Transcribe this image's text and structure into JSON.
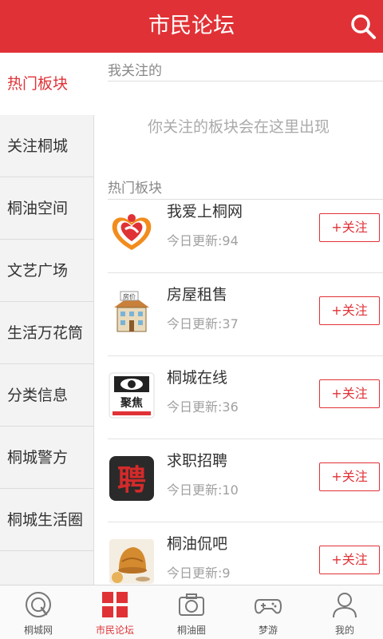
{
  "header": {
    "title": "市民论坛",
    "search_icon": "search-icon"
  },
  "sidebar": {
    "items": [
      {
        "label": "热门板块",
        "active": true
      },
      {
        "label": "关注桐城"
      },
      {
        "label": "桐油空间"
      },
      {
        "label": "文艺广场"
      },
      {
        "label": "生活万花筒"
      },
      {
        "label": "分类信息"
      },
      {
        "label": "桐城警方"
      },
      {
        "label": "桐城生活圈"
      }
    ]
  },
  "main": {
    "followed_title": "我关注的",
    "empty_hint": "你关注的板块会在这里出现",
    "hot_title": "热门板块",
    "boards": [
      {
        "name": "我爱上桐网",
        "update": "今日更新:94",
        "follow_label": "+关注",
        "icon": "heart-hands-logo-icon"
      },
      {
        "name": "房屋租售",
        "update": "今日更新:37",
        "follow_label": "+关注",
        "icon": "house-icon",
        "sign_text": "房价"
      },
      {
        "name": "桐城在线",
        "update": "今日更新:36",
        "follow_label": "+关注",
        "icon": "eye-focus-logo-icon",
        "sign_text": "聚焦"
      },
      {
        "name": "求职招聘",
        "update": "今日更新:10",
        "follow_label": "+关注",
        "icon": "hiring-character-icon",
        "sign_text": "聘"
      },
      {
        "name": "桐油侃吧",
        "update": "今日更新:9",
        "follow_label": "+关注",
        "icon": "cake-tea-icon"
      }
    ]
  },
  "bottom_nav": {
    "items": [
      {
        "label": "桐城网",
        "icon": "tongcheng-logo-icon"
      },
      {
        "label": "市民论坛",
        "icon": "grid-icon",
        "active": true
      },
      {
        "label": "桐油圈",
        "icon": "camera-icon"
      },
      {
        "label": "梦游",
        "icon": "gamepad-icon"
      },
      {
        "label": "我的",
        "icon": "user-icon"
      }
    ]
  },
  "colors": {
    "accent": "#e03236",
    "sidebar_bg": "#f3f3f3",
    "muted_text": "#a0a0a0"
  }
}
